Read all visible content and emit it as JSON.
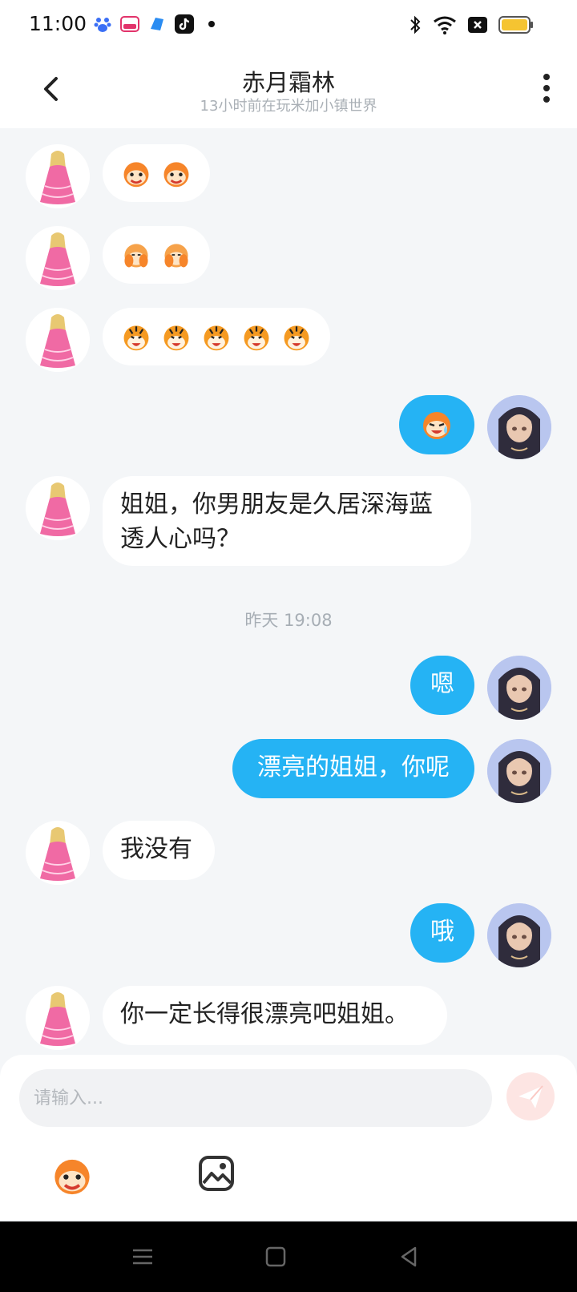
{
  "status_bar": {
    "time": "11:00",
    "battery_color": "#f5c431"
  },
  "header": {
    "title": "赤月霜林",
    "subtitle": "13小时前在玩米加小镇世界"
  },
  "conversation": {
    "messages": [
      {
        "sender": "other",
        "type": "sticker",
        "sticker": "monkey-face-pair",
        "count": 2
      },
      {
        "sender": "other",
        "type": "sticker",
        "sticker": "monkey-covering-face",
        "count": 2
      },
      {
        "sender": "other",
        "type": "sticker",
        "sticker": "tiger-face",
        "count": 5
      },
      {
        "sender": "self",
        "type": "sticker",
        "sticker": "crying-monkey-face",
        "count": 1
      },
      {
        "sender": "other",
        "type": "text",
        "text": "姐姐，你男朋友是久居深海蓝透人心吗？"
      },
      {
        "sender": "self",
        "type": "text",
        "text": "嗯"
      },
      {
        "sender": "self",
        "type": "text",
        "text": "漂亮的姐姐，你呢"
      },
      {
        "sender": "other",
        "type": "text",
        "text": "我没有"
      },
      {
        "sender": "self",
        "type": "text",
        "text": "哦"
      },
      {
        "sender": "other",
        "type": "text",
        "text": "你一定长得很漂亮吧姐姐。"
      }
    ],
    "timestamp": "昨天 19:08",
    "self_bubble_color": "#25b3f4",
    "other_bubble_color": "#ffffff"
  },
  "composer": {
    "placeholder": "请输入...",
    "value": "",
    "send_icon": "send-icon",
    "emoji_icon": "monkey-emoji-icon",
    "image_icon": "image-icon"
  },
  "nav_bar": {
    "icons": [
      "menu-icon",
      "home-icon",
      "back-icon"
    ]
  }
}
